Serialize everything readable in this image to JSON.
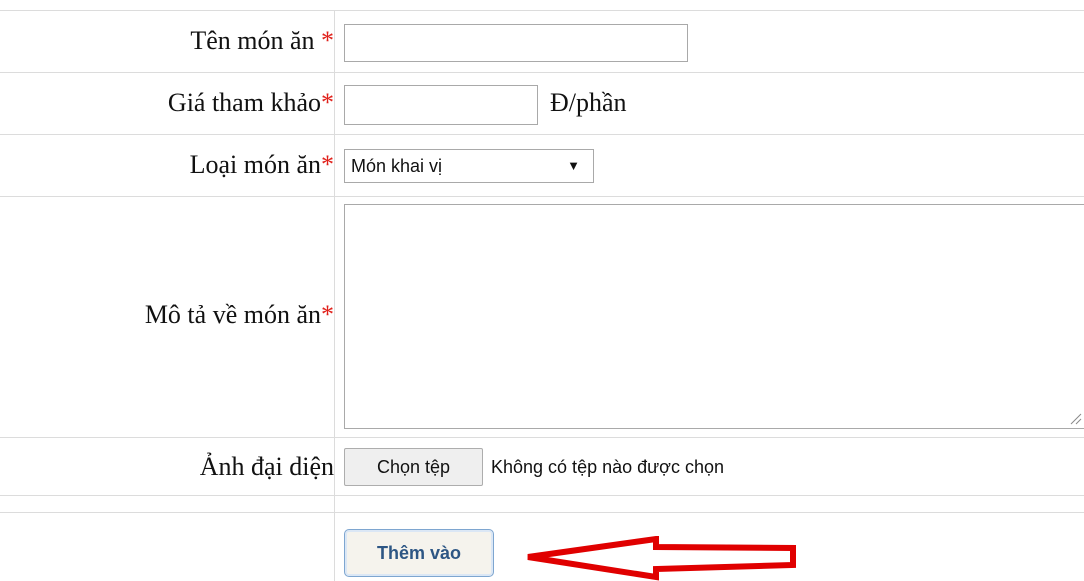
{
  "form": {
    "dish_name": {
      "label": "Tên món ăn ",
      "required_mark": "*",
      "value": ""
    },
    "reference_price": {
      "label": "Giá tham khảo",
      "required_mark": "*",
      "value": "",
      "unit": "Đ/phần"
    },
    "dish_type": {
      "label": "Loại món ăn",
      "required_mark": "*",
      "selected": "Món khai vị"
    },
    "description": {
      "label": "Mô tả về món ăn",
      "required_mark": "*",
      "value": ""
    },
    "avatar_image": {
      "label": "Ảnh đại diện",
      "button_label": "Chọn tệp",
      "status": "Không có tệp nào được chọn"
    },
    "submit_label": "Thêm vào"
  },
  "colors": {
    "required": "#e0201a",
    "grid_line": "#dcdcdc",
    "submit_text": "#2d5684",
    "annotation_arrow": "#e00000"
  },
  "icons": {
    "select_arrow": "triangle-down-icon",
    "annotation": "red-arrow-pointing-left"
  }
}
